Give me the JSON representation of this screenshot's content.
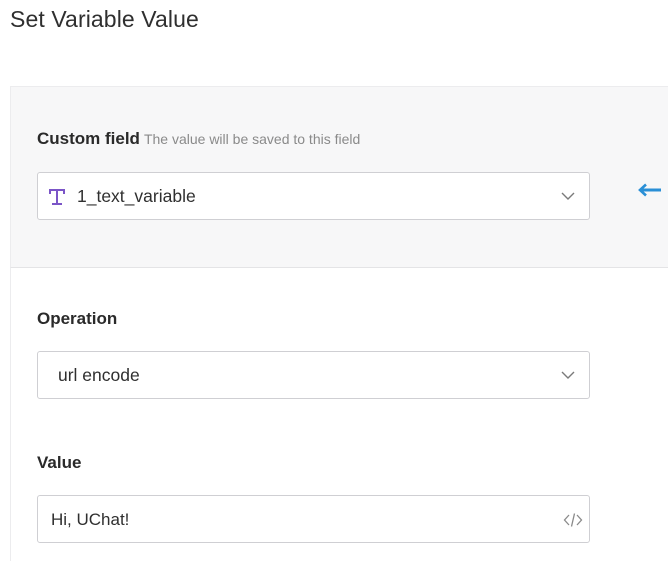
{
  "page": {
    "title": "Set Variable Value"
  },
  "custom_field": {
    "label": "Custom field",
    "hint": "The value will be saved to this field",
    "selected": "1_text_variable",
    "type_icon": "text-type-icon",
    "dropdown_icon": "chevron-down-icon",
    "side_icon": "arrow-left-icon",
    "icon_color": "#7b55c7",
    "arrow_color": "#2a8fd6"
  },
  "operation": {
    "label": "Operation",
    "selected": "url encode",
    "dropdown_icon": "chevron-down-icon"
  },
  "value": {
    "label": "Value",
    "text": "Hi, UChat!",
    "code_icon": "code-icon"
  }
}
